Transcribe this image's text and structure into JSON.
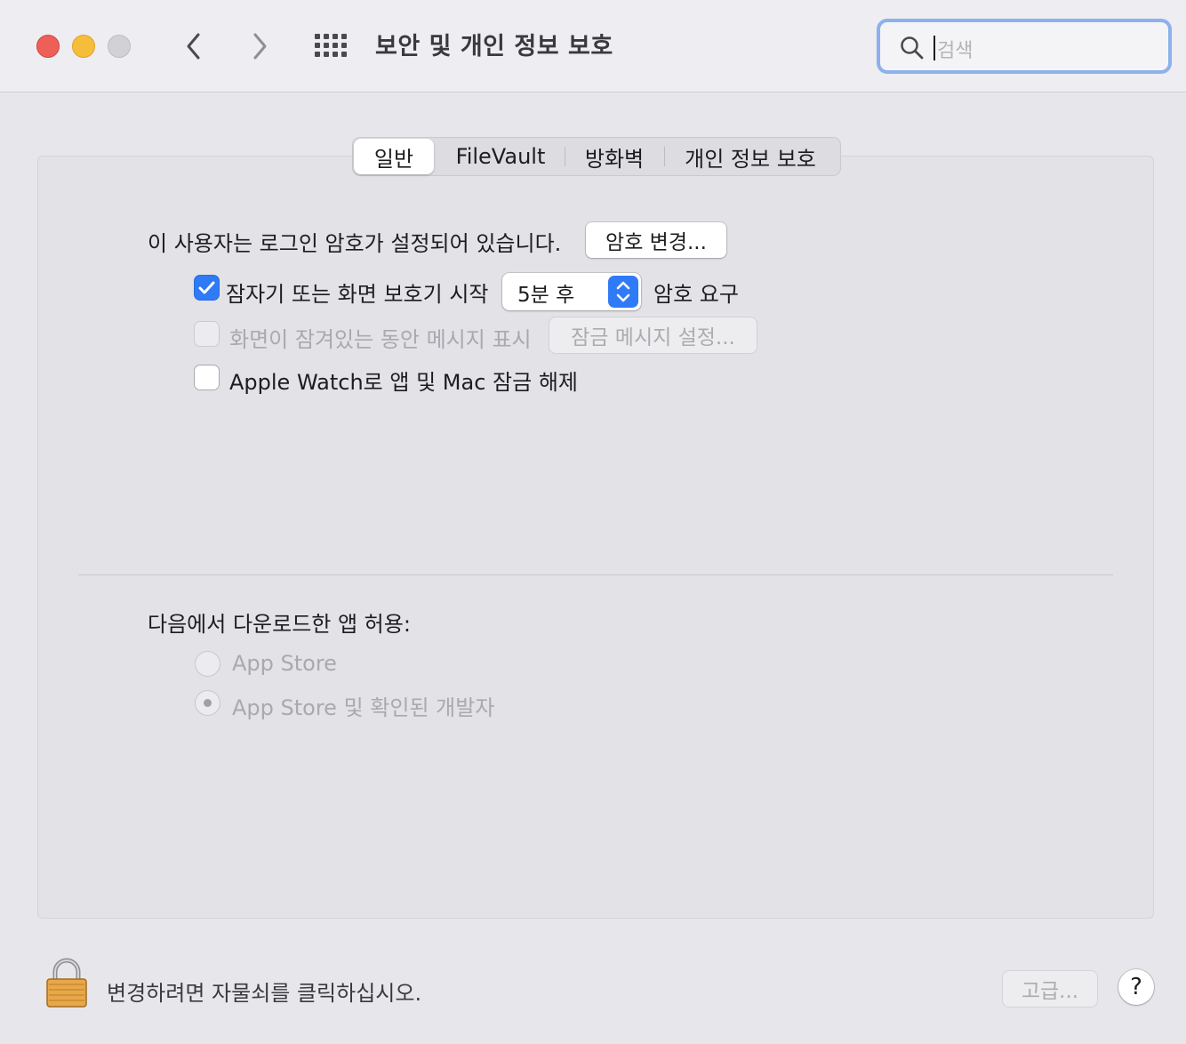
{
  "window": {
    "title": "보안 및 개인 정보 보호",
    "search_placeholder": "검색"
  },
  "tabs": [
    {
      "label": "일반",
      "active": true
    },
    {
      "label": "FileVault",
      "active": false
    },
    {
      "label": "방화벽",
      "active": false
    },
    {
      "label": "개인 정보 보호",
      "active": false
    }
  ],
  "general": {
    "password_text": "이 사용자는 로그인 암호가 설정되어 있습니다.",
    "change_password_button": "암호 변경...",
    "require_password": {
      "checked": true,
      "label": "잠자기 또는 화면 보호기 시작",
      "select_value": "5분 후",
      "suffix": "암호 요구"
    },
    "show_message": {
      "checked": false,
      "enabled": false,
      "label": "화면이 잠겨있는 동안 메시지 표시",
      "button": "잠금 메시지 설정..."
    },
    "apple_watch": {
      "checked": false,
      "label": "Apple Watch로 앱 및 Mac 잠금 해제"
    }
  },
  "downloads": {
    "heading": "다음에서 다운로드한 앱 허용:",
    "options": [
      {
        "label": "App Store",
        "selected": false
      },
      {
        "label": "App Store 및 확인된 개발자",
        "selected": true
      }
    ]
  },
  "footer": {
    "lock_text": "변경하려면 자물쇠를 클릭하십시오.",
    "advanced_button": "고급...",
    "help": "?"
  },
  "colors": {
    "accent": "#2f7af6",
    "close": "#ee5f57",
    "minimize": "#f6bd3a"
  }
}
